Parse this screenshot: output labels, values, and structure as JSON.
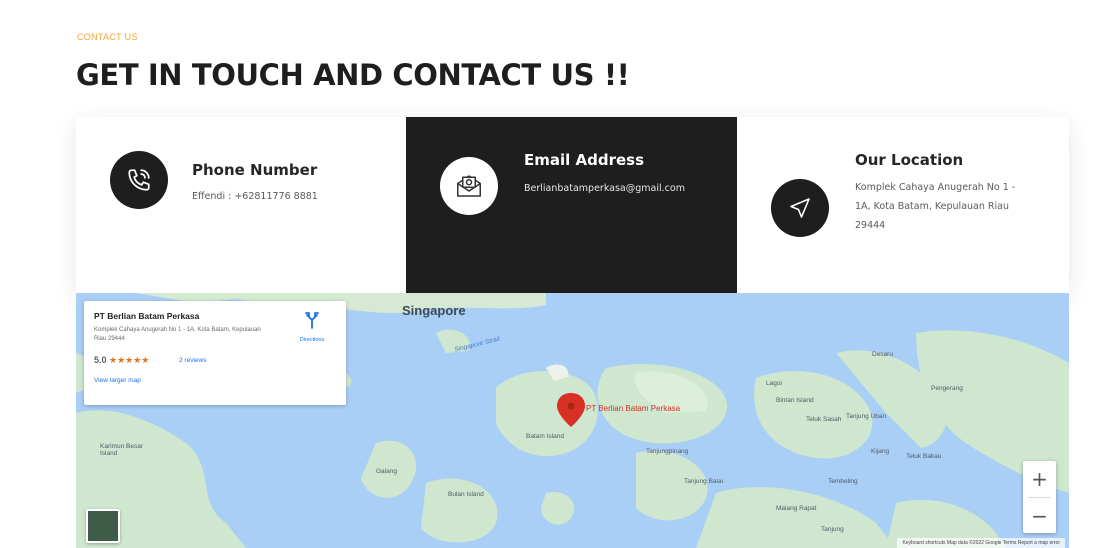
{
  "header": {
    "eyebrow": "CONTACT US",
    "title": "GET IN TOUCH AND CONTACT US !!"
  },
  "cards": [
    {
      "title": "Phone Number",
      "text": "Effendi : +62811776 8881",
      "icon": "phone-icon"
    },
    {
      "title": "Email Address",
      "text": "Berlianbatamperkasa@gmail.com",
      "icon": "envelope-icon"
    },
    {
      "title": "Our Location",
      "text": "Komplek Cahaya Anugerah No 1 - 1A, Kota Batam, Kepulauan Riau 29444",
      "icon": "navigation-arrow-icon"
    }
  ],
  "map": {
    "info_card": {
      "title": "PT Berlian Batam Perkasa",
      "address": "Komplek Cahaya Anugerah No 1 - 1A, Kota Batam, Kepulauan Riau 29444",
      "rating": "5.0",
      "stars": "★★★★★",
      "reviews": "2 reviews",
      "directions": "Directions",
      "larger_map": "View larger map"
    },
    "marker_label": "PT Berlian Batam Perkasa",
    "labels": {
      "singapore": "Singapore",
      "singapore_strait": "Singapore Strait",
      "batam": "Batam Island",
      "bintan": "Bintan Island",
      "tanjungpinang": "Tanjungpinang",
      "karimun": "Karimun Besar Island",
      "galang": "Galang",
      "tanjungbalai": "Tanjung Balai",
      "bulan": "Bulan Island",
      "tembeling": "Tembeling",
      "kijang": "Kijang",
      "lagoi": "Lagoi",
      "telukbakau": "Teluk Bakau",
      "tanjunguban": "Tanjung Uban",
      "desaru": "Desaru",
      "pengerang": "Pengerang",
      "teluksasah": "Teluk Sasah",
      "malang": "Malang Rapat",
      "tarempa": "Tanjung"
    },
    "zoom_in": "+",
    "zoom_out": "−",
    "footer": "Keyboard shortcuts   Map data ©2022 Google   Terms   Report a map error"
  },
  "colors": {
    "accent": "#f2a33a",
    "dark": "#1e1e1e",
    "water": "#aacff7",
    "land": "#cfe7cf",
    "marker": "#d93025"
  }
}
